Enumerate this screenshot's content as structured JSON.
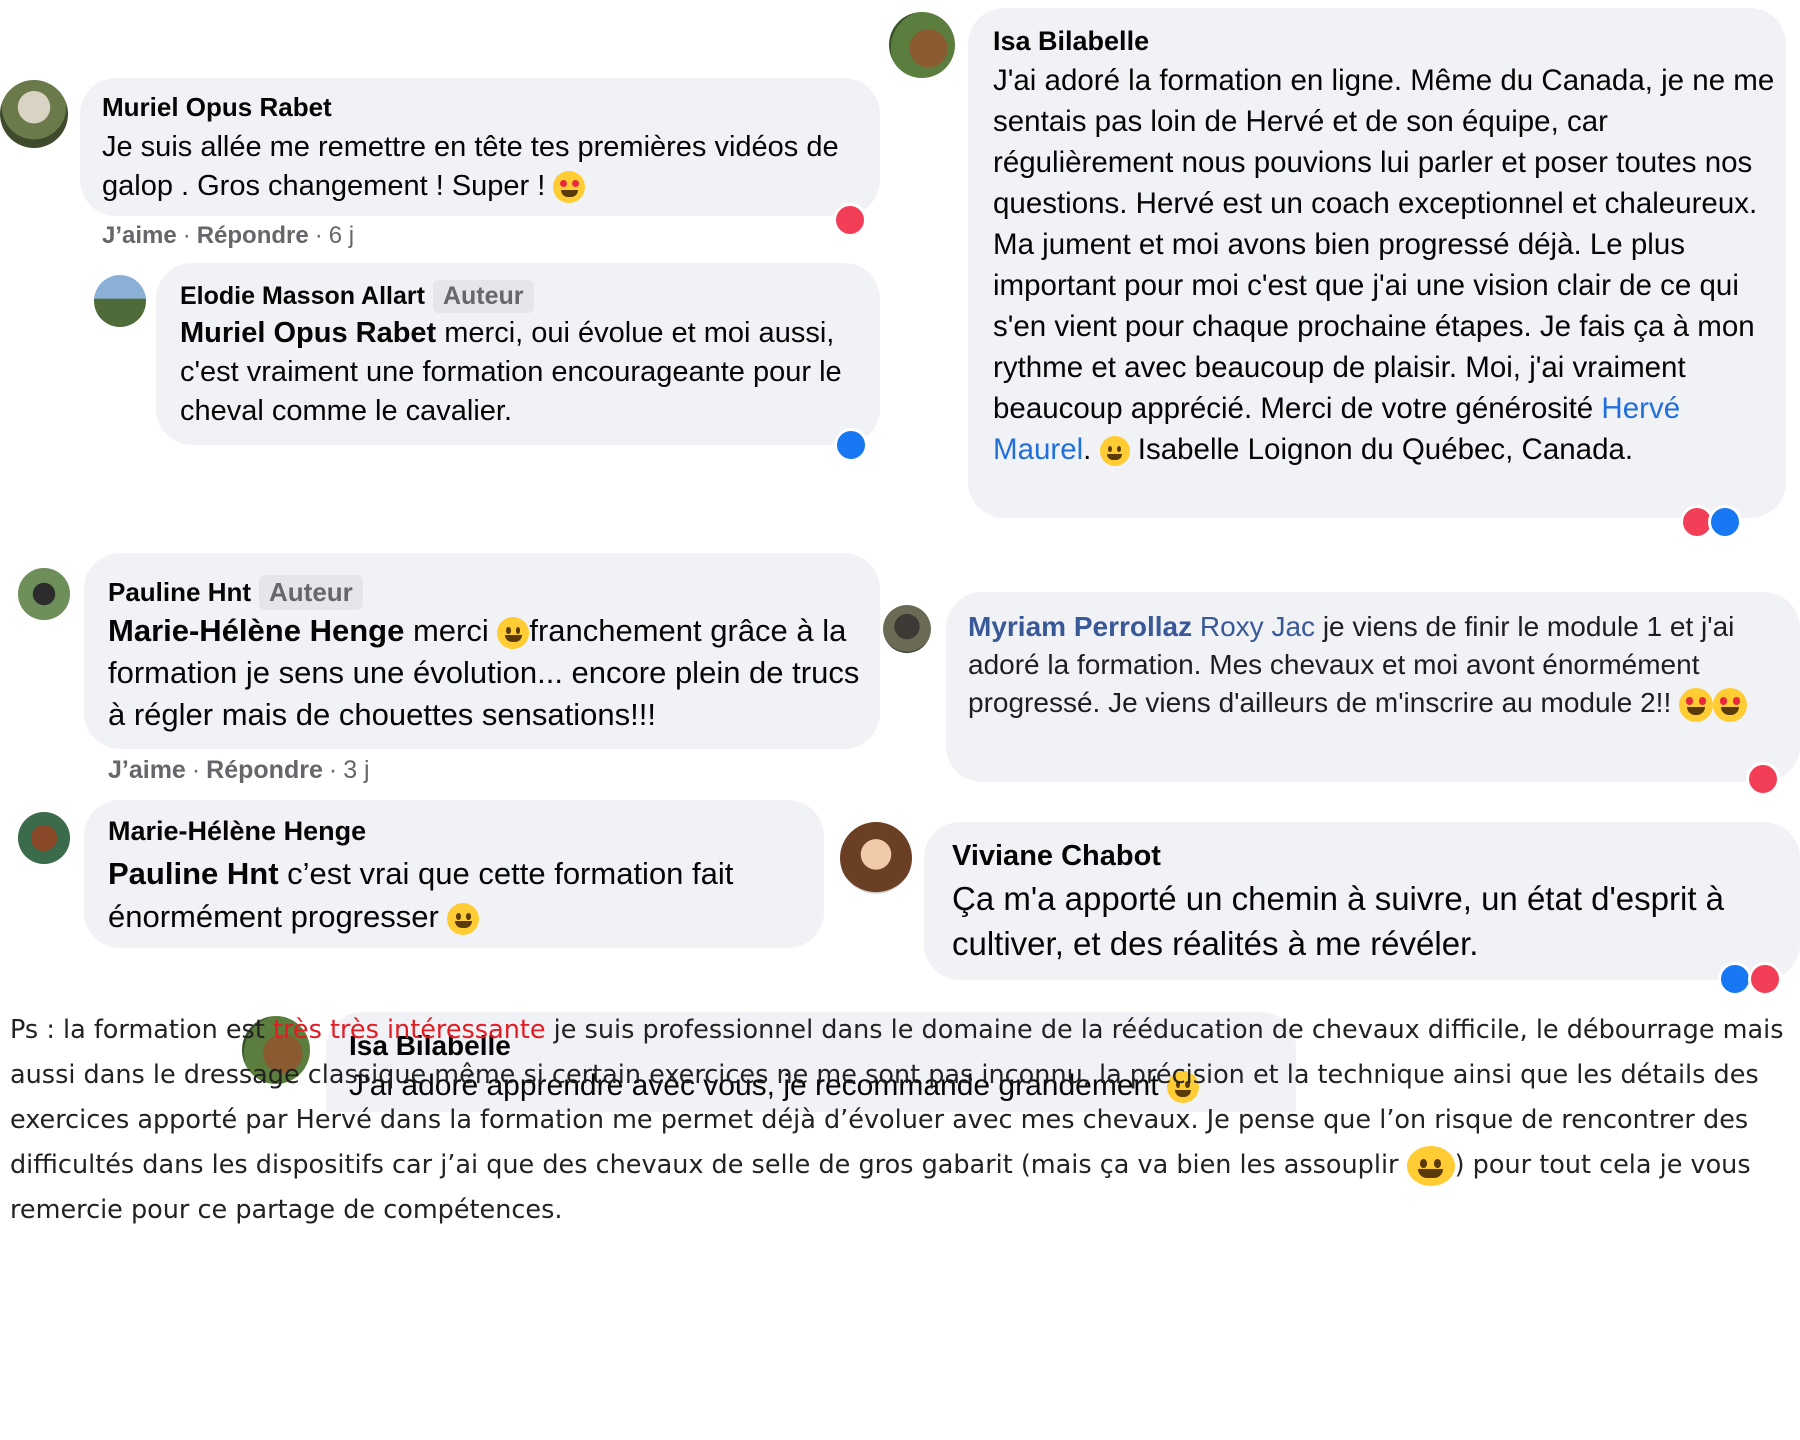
{
  "comments": {
    "muriel": {
      "author": "Muriel Opus Rabet",
      "text": "Je suis allée me remettre en tête tes premières vidéos de galop . Gros changement ! Super !",
      "like": "J’aime",
      "reply": "Répondre",
      "time": "6 j"
    },
    "elodie": {
      "author": "Elodie Masson Allart",
      "badge": "Auteur",
      "mention": "Muriel Opus Rabet",
      "text": " merci, oui évolue et moi aussi, c'est vraiment une formation encourageante pour le cheval comme le cavalier."
    },
    "isa_long": {
      "author": "Isa Bilabelle",
      "text_before": "J'ai adoré la formation en ligne. Même du Canada, je ne me sentais pas loin de Hervé et de son équipe, car régulièrement nous pouvions lui parler et poser toutes nos questions. Hervé est un coach exceptionnel et chaleureux. Ma jument et moi avons bien progressé déjà. Le plus important pour moi c'est que j'ai une vision clair de ce qui s'en vient pour chaque prochaine étapes. Je fais ça à mon rythme et avec beaucoup de plaisir. Moi, j'ai vraiment beaucoup apprécié. Merci de votre générosité ",
      "link": "Hervé Maurel",
      "text_after_link": ".",
      "text_end": " Isabelle Loignon du Québec, Canada."
    },
    "pauline": {
      "author": "Pauline Hnt",
      "badge": "Auteur",
      "mention": "Marie-Hélène Henge",
      "text_a": " merci ",
      "text_b": "franchement grâce à la formation je sens une évolution... encore plein de trucs à régler mais de chouettes sensations!!!",
      "like": "J’aime",
      "reply": "Répondre",
      "time": "3 j"
    },
    "myriam": {
      "author": "Myriam Perrollaz",
      "mention": "Roxy Jac",
      "text": " je viens de finir le module 1 et j'ai adoré la formation. Mes chevaux et moi avont énormément progressé. Je viens d'ailleurs de m'inscrire au module 2!!"
    },
    "marie": {
      "author": "Marie-Hélène Henge",
      "mention": "Pauline Hnt",
      "text": " c’est vrai que cette formation fait énormément progresser"
    },
    "viviane": {
      "author": "Viviane Chabot",
      "text": "Ça m'a apporté un chemin à suivre, un état d'esprit à cultiver, et des réalités à me révéler."
    },
    "isa_short": {
      "author": "Isa Bilabelle",
      "text": "J'ai adoré apprendre avec vous, je recommande grandement"
    }
  },
  "ps": {
    "prefix": "Ps : la formation est ",
    "highlight": "très très intéressante",
    "body": " je suis professionnel dans le domaine de la rééducation de chevaux difficile, le débourrage mais aussi dans le dressage classique même si certain exercices ne me sont pas inconnu, la précision et la technique ainsi que les détails des exercices apporté par Hervé dans la formation me permet déjà d’évoluer avec mes chevaux. Je pense que l’on risque de rencontrer des difficultés dans les dispositifs car j’ai que des chevaux de selle de gros gabarit (mais ça va bien les assouplir ",
    "end": ") pour tout cela je vous remercie pour ce partage de compétences."
  },
  "colors": {
    "bubble": "#f0f2f5",
    "link": "#216fdb",
    "highlight": "#e31b23",
    "muted": "#65676b"
  }
}
